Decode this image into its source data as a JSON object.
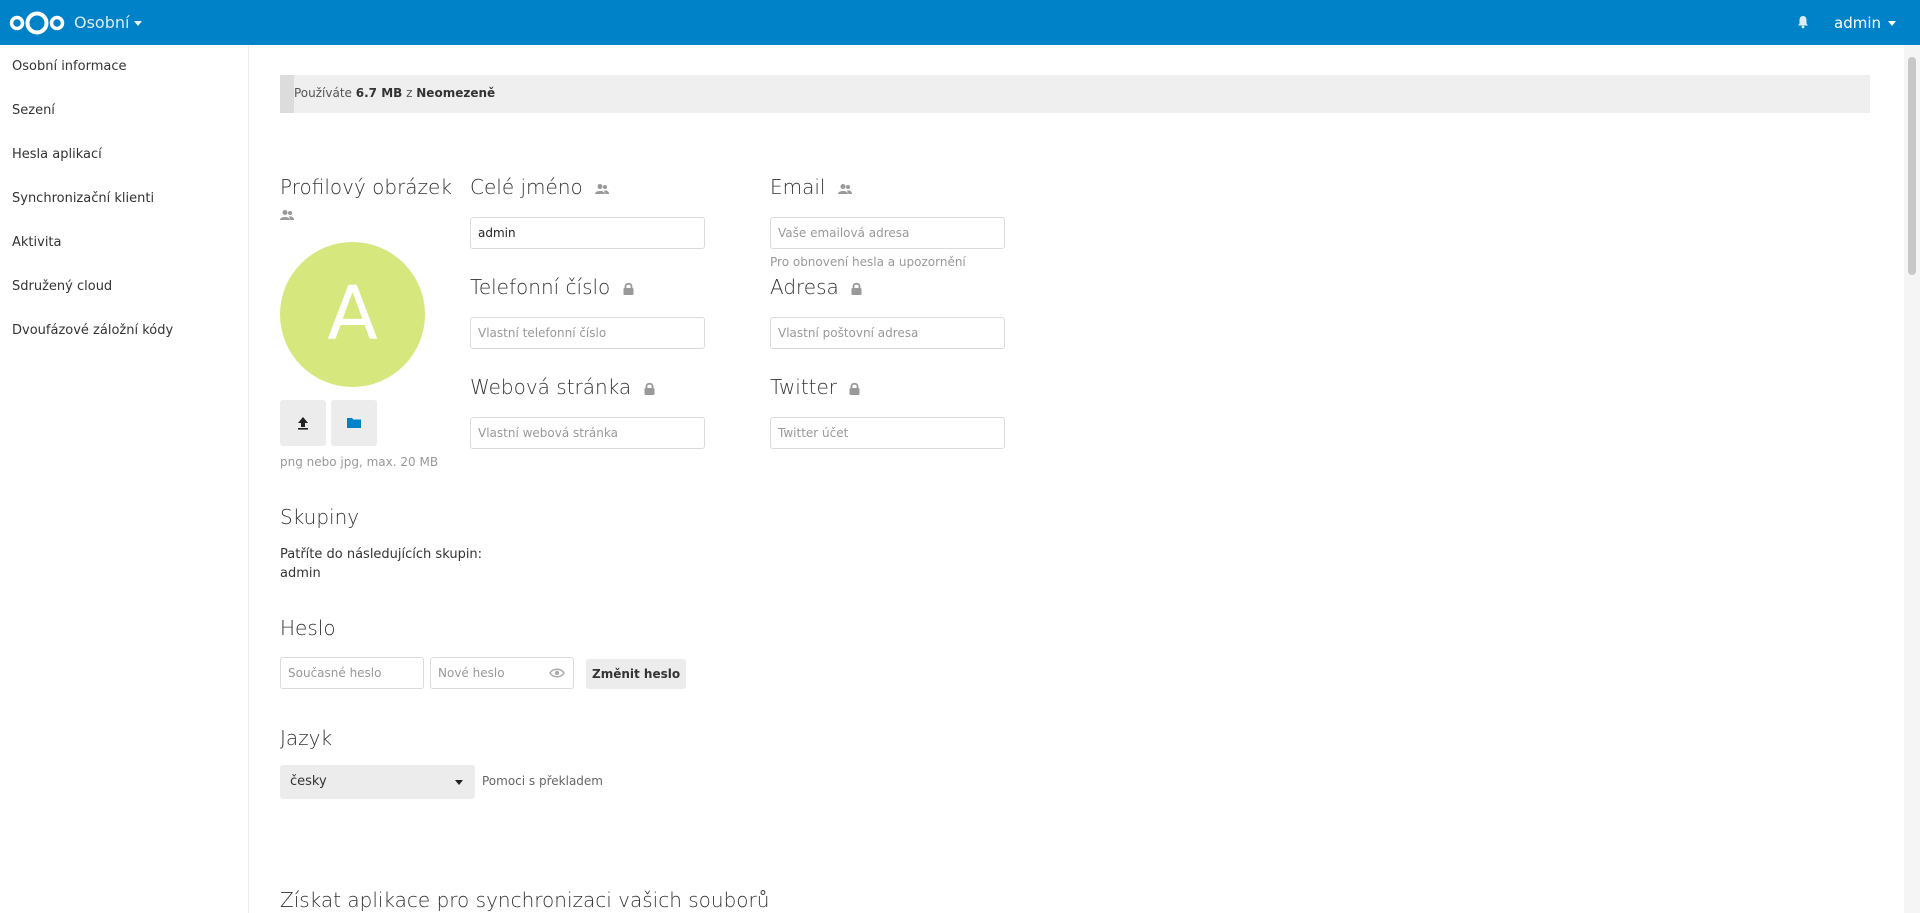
{
  "header": {
    "app_name": "Osobní",
    "user_name": "admin",
    "colors": {
      "header_bg": "#0082c9"
    },
    "icons": {
      "logo": "nextcloud-logo-icon",
      "notifications": "bell-icon"
    }
  },
  "sidebar": {
    "items": [
      {
        "label": "Osobní informace"
      },
      {
        "label": "Sezení"
      },
      {
        "label": "Hesla aplikací"
      },
      {
        "label": "Synchronizační klienti"
      },
      {
        "label": "Aktivita"
      },
      {
        "label": "Sdružený cloud"
      },
      {
        "label": "Dvoufázové záložní kódy"
      }
    ]
  },
  "quota": {
    "prefix": "Používáte",
    "used": "6.7 MB",
    "middle": "z",
    "total": "Neomezeně",
    "fill_fraction": 0.008
  },
  "profile": {
    "picture_heading": "Profilový obrázek",
    "avatar_letter": "A",
    "avatar_color": "#d6e87d",
    "upload_hint": "png nebo jpg, max. 20 MB",
    "full_name": {
      "label": "Celé jméno",
      "value": "admin"
    },
    "email": {
      "label": "Email",
      "placeholder": "Vaše emailová adresa",
      "hint": "Pro obnovení hesla a upozornění"
    },
    "phone": {
      "label": "Telefonní číslo",
      "placeholder": "Vlastní telefonní číslo"
    },
    "address": {
      "label": "Adresa",
      "placeholder": "Vlastní poštovní adresa"
    },
    "website": {
      "label": "Webová stránka",
      "placeholder": "Vlastní webová stránka"
    },
    "twitter": {
      "label": "Twitter",
      "placeholder": "Twitter účet"
    }
  },
  "groups": {
    "heading": "Skupiny",
    "intro": "Patříte do následujících skupin:",
    "list": "admin"
  },
  "password": {
    "heading": "Heslo",
    "current_placeholder": "Současné heslo",
    "new_placeholder": "Nové heslo",
    "change_button": "Změnit heslo"
  },
  "language": {
    "heading": "Jazyk",
    "selected": "česky",
    "help_link": "Pomoci s překladem"
  },
  "sync": {
    "heading": "Získat aplikace pro synchronizaci vašich souborů"
  }
}
